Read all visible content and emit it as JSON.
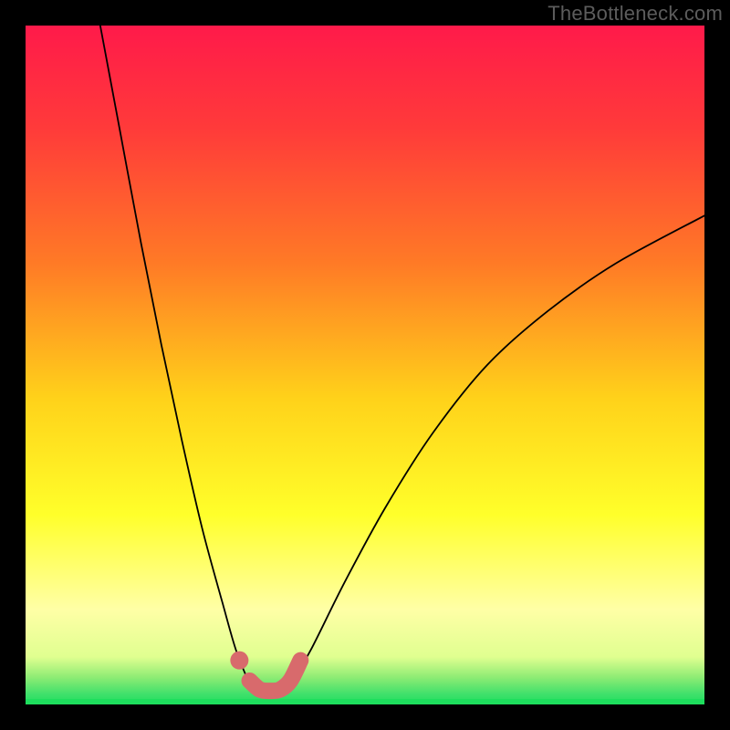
{
  "watermark": "TheBottleneck.com",
  "chart_data": {
    "type": "line",
    "title": "",
    "xlabel": "",
    "ylabel": "",
    "xlim": [
      0,
      100
    ],
    "ylim": [
      0,
      100
    ],
    "gradient_stops": [
      {
        "offset": 0.0,
        "color": "#ff1a4a"
      },
      {
        "offset": 0.15,
        "color": "#ff3a3a"
      },
      {
        "offset": 0.35,
        "color": "#ff7a26"
      },
      {
        "offset": 0.55,
        "color": "#ffd21a"
      },
      {
        "offset": 0.72,
        "color": "#ffff2a"
      },
      {
        "offset": 0.86,
        "color": "#ffffa6"
      },
      {
        "offset": 0.93,
        "color": "#e0ff90"
      },
      {
        "offset": 0.96,
        "color": "#8eec74"
      },
      {
        "offset": 0.985,
        "color": "#3fe06b"
      },
      {
        "offset": 1.0,
        "color": "#1ede5d"
      }
    ],
    "series": [
      {
        "name": "left-branch",
        "color": "#000000",
        "stroke_width": 1.8,
        "x": [
          11,
          14,
          17,
          20,
          23,
          26,
          29,
          31,
          33
        ],
        "y": [
          100,
          84,
          68,
          53,
          39,
          26,
          15,
          8,
          3
        ]
      },
      {
        "name": "right-branch",
        "color": "#000000",
        "stroke_width": 1.8,
        "x": [
          39,
          42,
          47,
          53,
          60,
          68,
          77,
          87,
          100
        ],
        "y": [
          3,
          8,
          18,
          29,
          40,
          50,
          58,
          65,
          72
        ]
      },
      {
        "name": "green-band",
        "color": "#1ede5d",
        "stroke_width": 0,
        "x": [
          0,
          100
        ],
        "y": [
          0,
          0
        ]
      }
    ],
    "marker": {
      "color": "#d86a6c",
      "stroke_width": 18,
      "dot_radius": 10,
      "points_x": [
        31.5,
        33,
        34.5,
        36.0,
        37.5,
        39.0,
        40.5
      ],
      "points_y": [
        6.5,
        3.5,
        2.2,
        2.0,
        2.2,
        3.5,
        6.5
      ]
    }
  }
}
